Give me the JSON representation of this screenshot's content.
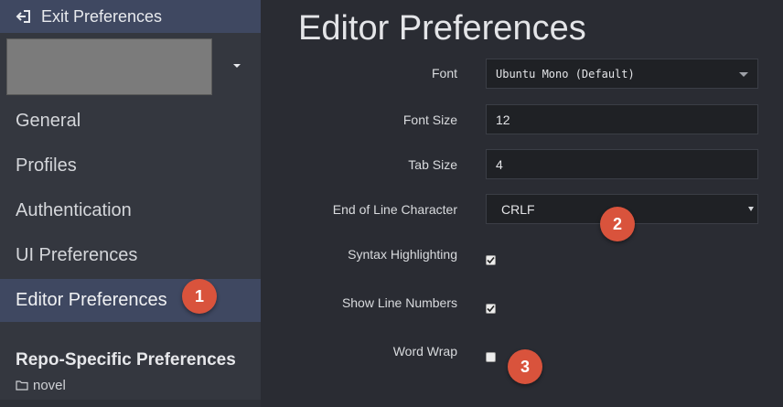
{
  "sidebar": {
    "exit_label": "Exit Preferences",
    "items": [
      {
        "label": "General"
      },
      {
        "label": "Profiles"
      },
      {
        "label": "Authentication"
      },
      {
        "label": "UI Preferences"
      },
      {
        "label": "Editor Preferences",
        "active": true
      }
    ],
    "repo_section_title": "Repo-Specific Preferences",
    "repo_item": "novel"
  },
  "main": {
    "title": "Editor Preferences",
    "font": {
      "label": "Font",
      "value": "Ubuntu Mono (Default)"
    },
    "font_size": {
      "label": "Font Size",
      "value": "12"
    },
    "tab_size": {
      "label": "Tab Size",
      "value": "4"
    },
    "eol": {
      "label": "End of Line Character",
      "value": "CRLF"
    },
    "syntax_highlighting": {
      "label": "Syntax Highlighting",
      "checked": true
    },
    "show_line_numbers": {
      "label": "Show Line Numbers",
      "checked": true
    },
    "word_wrap": {
      "label": "Word Wrap",
      "checked": false
    }
  },
  "annotations": [
    "1",
    "2",
    "3"
  ],
  "colors": {
    "sidebar_bg": "#34373f",
    "active_bg": "#3f4861",
    "main_bg": "#2a2c33",
    "badge": "#d9533c"
  },
  "icons": {
    "exit": "sign-out-icon",
    "folder": "folder-icon",
    "check": "check-icon"
  }
}
